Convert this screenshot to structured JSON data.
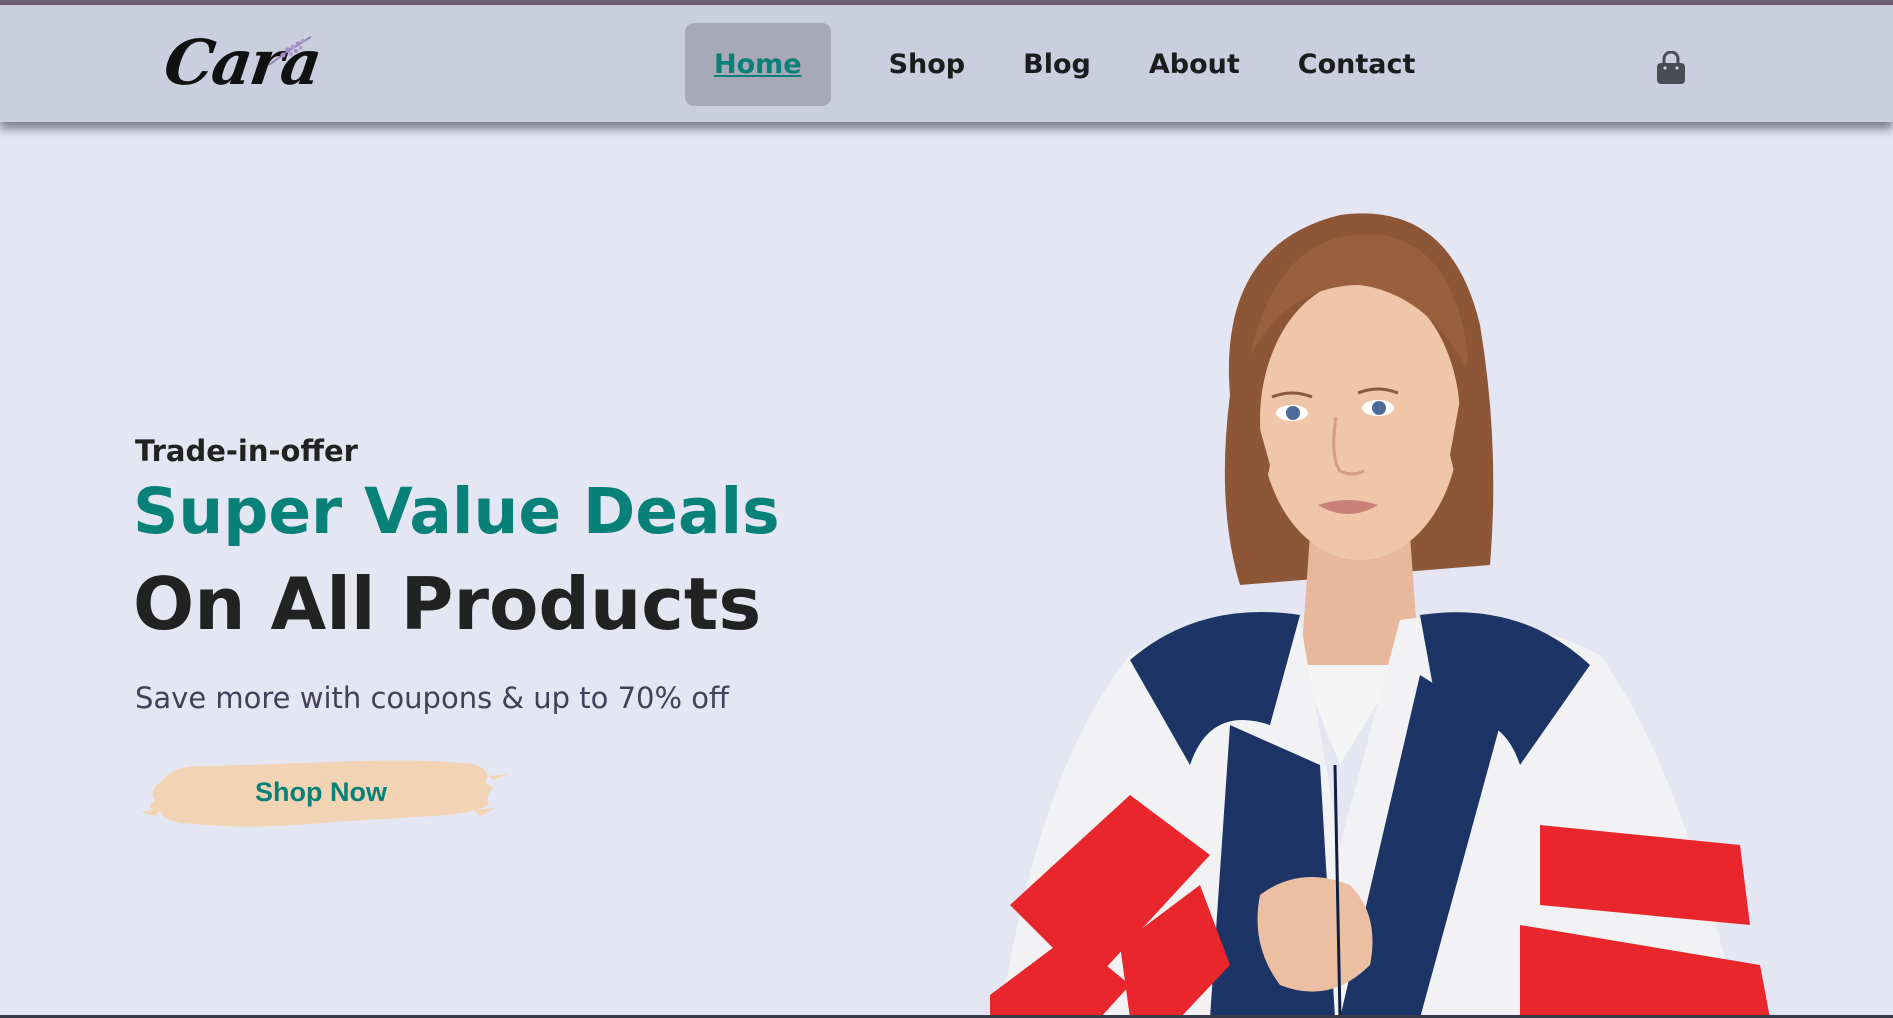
{
  "header": {
    "logo_text": "Cara",
    "nav": [
      {
        "label": "Home",
        "active": true
      },
      {
        "label": "Shop",
        "active": false
      },
      {
        "label": "Blog",
        "active": false
      },
      {
        "label": "About",
        "active": false
      },
      {
        "label": "Contact",
        "active": false
      }
    ],
    "cart_icon": "shopping-bag-icon"
  },
  "hero": {
    "kicker": "Trade-in-offer",
    "headline_line1": "Super Value Deals",
    "headline_line2": "On All Products",
    "subtext": "Save more with coupons & up to 70% off",
    "cta_label": "Shop Now",
    "image": "model-in-red-white-navy-windbreaker"
  },
  "colors": {
    "accent": "#088178",
    "background": "#e4e6f3",
    "header_bg": "#cbcede",
    "cta_bg": "#f2d4b4",
    "text_dark": "#222222"
  }
}
